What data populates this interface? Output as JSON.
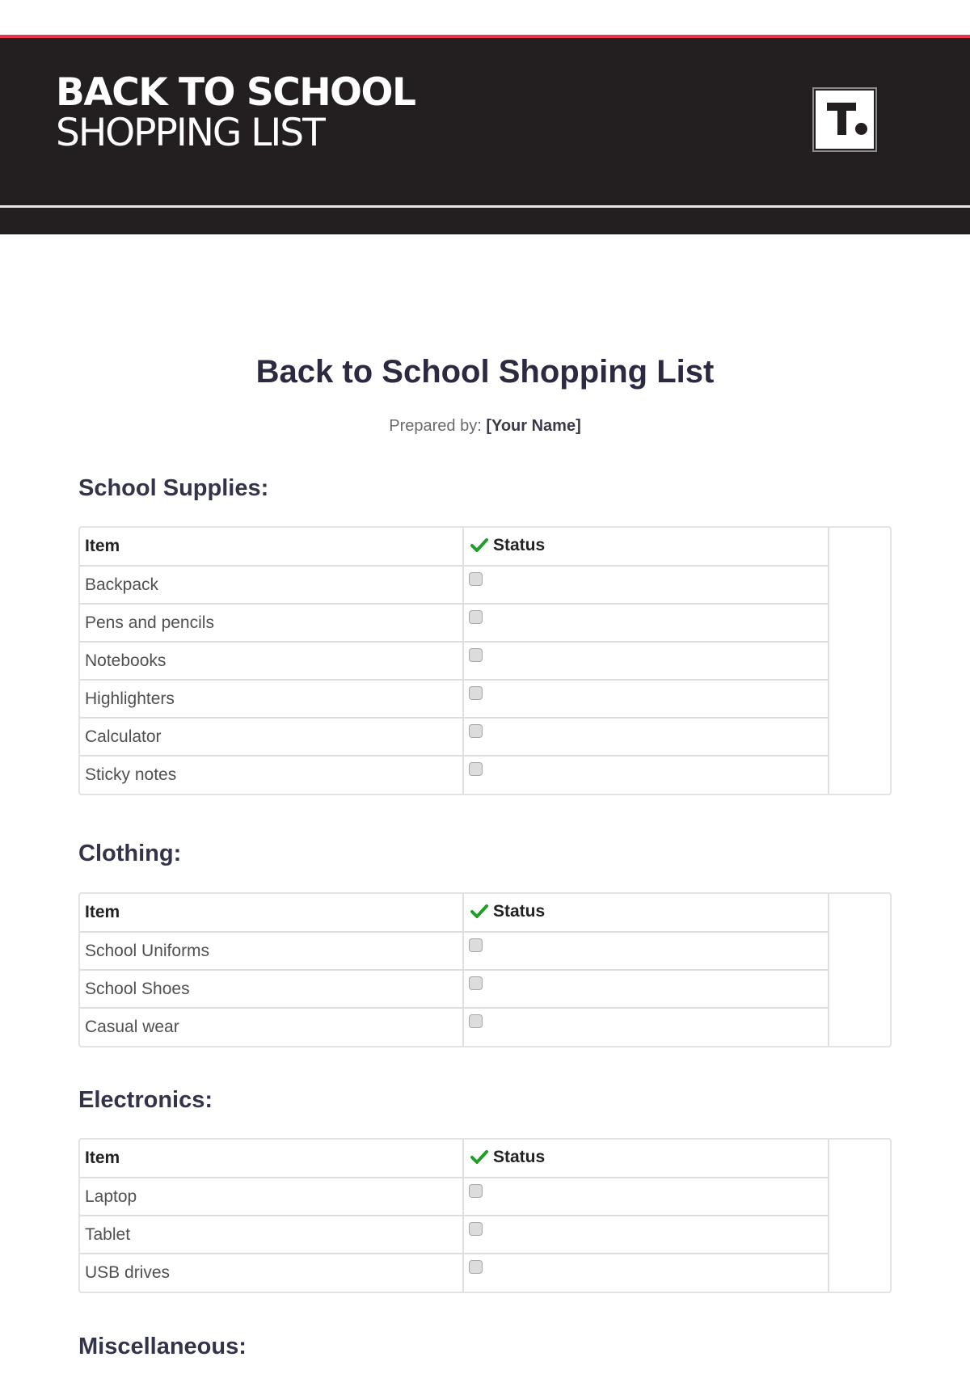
{
  "header": {
    "title_line1": "BACK TO SCHOOL",
    "title_line2": "SHOPPING LIST",
    "logo_icon": "template-logo-t",
    "accent_color": "#e8354b",
    "background_color": "#231f20"
  },
  "document": {
    "title": "Back to School Shopping List",
    "prepared_by_label": "Prepared by:",
    "prepared_by_value": "[Your Name]"
  },
  "table_headers": {
    "item": "Item",
    "status": "Status",
    "status_icon": "check-mark-icon"
  },
  "sections": [
    {
      "heading": "School Supplies:",
      "items": [
        {
          "name": "Backpack",
          "checked": false
        },
        {
          "name": "Pens and pencils",
          "checked": false
        },
        {
          "name": "Notebooks",
          "checked": false
        },
        {
          "name": "Highlighters",
          "checked": false
        },
        {
          "name": "Calculator",
          "checked": false
        },
        {
          "name": "Sticky notes",
          "checked": false
        }
      ]
    },
    {
      "heading": "Clothing:",
      "items": [
        {
          "name": "School Uniforms",
          "checked": false
        },
        {
          "name": "School Shoes",
          "checked": false
        },
        {
          "name": "Casual wear",
          "checked": false
        }
      ]
    },
    {
      "heading": "Electronics:",
      "items": [
        {
          "name": "Laptop",
          "checked": false
        },
        {
          "name": "Tablet",
          "checked": false
        },
        {
          "name": "USB drives",
          "checked": false
        }
      ]
    },
    {
      "heading": "Miscellaneous:",
      "items": []
    }
  ]
}
